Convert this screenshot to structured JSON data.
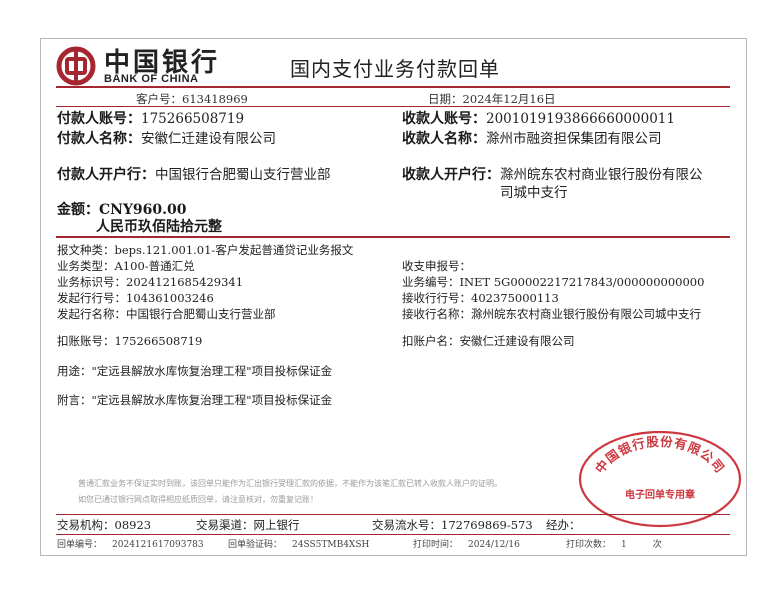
{
  "header": {
    "bank_name_cn": "中国银行",
    "bank_name_en": "BANK OF CHINA",
    "title": "国内支付业务付款回单"
  },
  "meta": {
    "customer_no": "客户号：613418969",
    "date": "日期：2024年12月16日"
  },
  "payer": {
    "account_label": "付款人账号：",
    "account": "175266508719",
    "name_label": "付款人名称：",
    "name": "安徽仁迁建设有限公司",
    "bank_label": "付款人开户行：",
    "bank": "中国银行合肥蜀山支行营业部"
  },
  "payee": {
    "account_label": "收款人账号：",
    "account": "2001019193866660000011",
    "name_label": "收款人名称：",
    "name": "滁州市融资担保集团有限公司",
    "bank_label": "收款人开户行：",
    "bank_line1": "滁州皖东农村商业银行股份有限公",
    "bank_line2": "司城中支行"
  },
  "amount": {
    "label": "金额：",
    "value": "CNY960.00",
    "words": "人民币玖佰陆拾元整"
  },
  "details": {
    "msg_type": "报文种类：beps.121.001.01-客户发起普通贷记业务报文",
    "biz_type": "业务类型：A100-普通汇兑",
    "biz_id": "业务标识号：2024121685429341",
    "sender_no": "发起行行号：104361003246",
    "sender_name": "发起行名称：中国银行合肥蜀山支行营业部",
    "debit_acct": "扣账账号：175266508719",
    "purpose": "用途：\"定远县解放水库恢复治理工程\"项目投标保证金",
    "remark": "附言：\"定远县解放水库恢复治理工程\"项目投标保证金",
    "recv_no": "收支申报号：",
    "biz_code": "业务编号：INET 5G00002217217843/000000000000",
    "recv_bank_no": "接收行行号：402375000113",
    "recv_bank_name": "接收行名称：滁州皖东农村商业银行股份有限公司城中支行",
    "debit_name": "扣账户名：安徽仁迁建设有限公司"
  },
  "notice": {
    "line1": "普通汇款业务不保证实时到账，该回单只能作为汇出银行受理汇款的依据，不能作为该笔汇款已转入收款人账户的证明。",
    "line2": "如您已通过银行网点取得相应纸质回单，请注意核对，勿重复记账！"
  },
  "footer": {
    "org": "交易机构：08923",
    "channel": "交易渠道：网上银行",
    "serial": "交易流水号：172769869-573",
    "handler": "经办：",
    "receipt_no_label": "回单编号：",
    "receipt_no": "2024121617093783",
    "verify_label": "回单验证码：",
    "verify": "24SS5TMB4XSH",
    "print_date_label": "打印时间：",
    "print_date": "2024/12/16",
    "print_count_label": "打印次数：",
    "print_count": "1",
    "print_count_unit": "次"
  },
  "stamp": {
    "text_arc": "中国银行股份有限公司",
    "text_center": "电子回单专用章"
  },
  "colors": {
    "brand_red": "#a52630",
    "stamp_red": "#c8232c"
  }
}
